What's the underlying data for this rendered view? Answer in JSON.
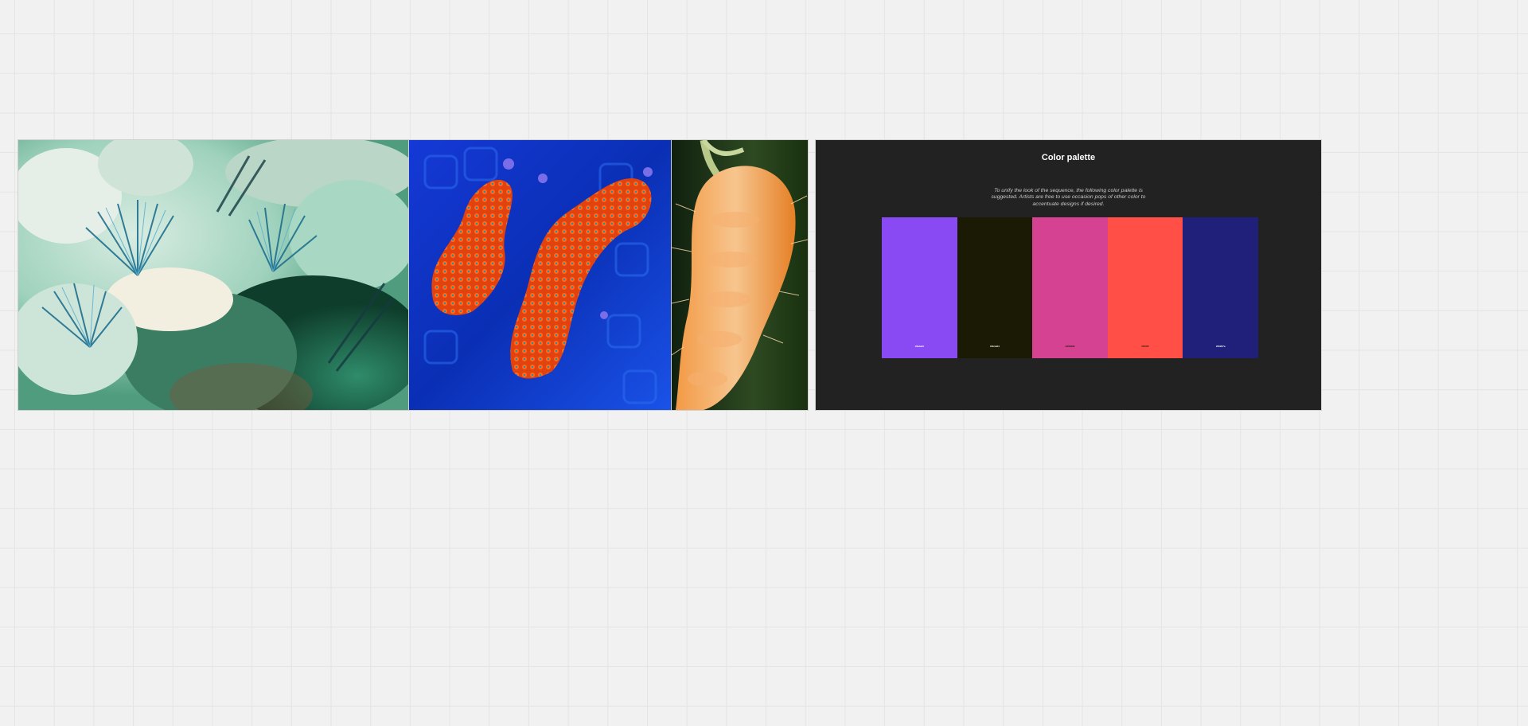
{
  "canvas": {
    "background": "#f1f1f1",
    "grid_color": "#e4e4e4"
  },
  "images": [
    {
      "subject": "blue-green crystal mineral",
      "icon": "image-mineral"
    },
    {
      "subject": "orange coral on blue background",
      "icon": "image-coral"
    },
    {
      "subject": "orange fuzzy caterpillar",
      "icon": "image-caterpillar"
    }
  ],
  "palette": {
    "title": "Color palette",
    "description": "To unify the look of the sequence, the following color palette is suggested. Artists are free to use occasion pops of other color to accentuate designs if desired.",
    "background": "#222222",
    "swatches": [
      {
        "color": "#8a4af3",
        "hex": "#8a4af3",
        "label_color": "#ffffff"
      },
      {
        "color": "#1b1a04",
        "hex": "#1b1a04",
        "label_color": "#ffffff"
      },
      {
        "color": "#d64292",
        "hex": "#d64292",
        "label_color": "#1b1a04"
      },
      {
        "color": "#ff4f47",
        "hex": "#ff4f47",
        "label_color": "#1b1a04"
      },
      {
        "color": "#20207a",
        "hex": "#20207a",
        "label_color": "#ffffff"
      }
    ]
  }
}
